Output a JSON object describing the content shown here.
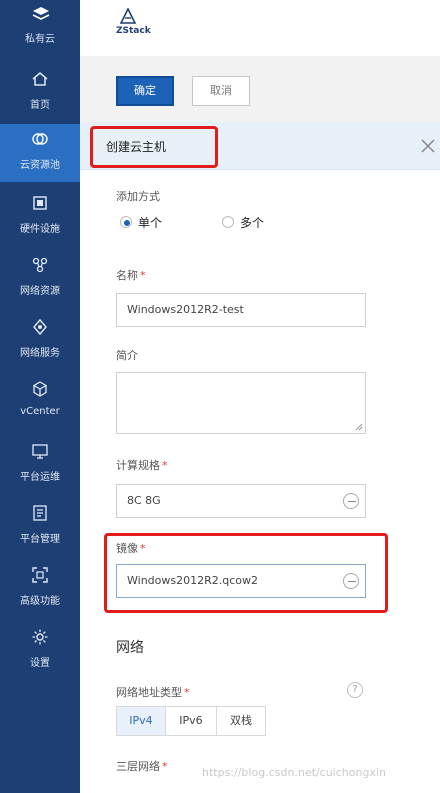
{
  "sidebar": {
    "brand_label": "私有云",
    "items": [
      {
        "label": "首页",
        "icon": "home-icon"
      },
      {
        "label": "云资源池",
        "icon": "cloud-pool-icon",
        "active": true
      },
      {
        "label": "硬件设施",
        "icon": "hardware-icon"
      },
      {
        "label": "网络资源",
        "icon": "network-resource-icon"
      },
      {
        "label": "网络服务",
        "icon": "network-service-icon"
      },
      {
        "label": "vCenter",
        "icon": "vcenter-icon"
      },
      {
        "label": "平台运维",
        "icon": "platform-ops-icon"
      },
      {
        "label": "平台管理",
        "icon": "platform-manage-icon"
      },
      {
        "label": "高级功能",
        "icon": "advanced-icon"
      },
      {
        "label": "设置",
        "icon": "settings-icon"
      }
    ]
  },
  "brand": {
    "name": "ZStack"
  },
  "toolbar": {
    "ok_label": "确定",
    "cancel_label": "取消"
  },
  "page": {
    "title": "创建云主机"
  },
  "form": {
    "add_method_label": "添加方式",
    "add_method_options": [
      "单个",
      "多个"
    ],
    "add_method_selected": "单个",
    "name_label": "名称",
    "name_value": "Windows2012R2-test",
    "desc_label": "简介",
    "desc_value": "",
    "spec_label": "计算规格",
    "spec_value": "8C 8G",
    "image_label": "镜像",
    "image_value": "Windows2012R2.qcow2",
    "network_title": "网络",
    "net_type_label": "网络地址类型",
    "net_type_options": [
      "IPv4",
      "IPv6",
      "双栈"
    ],
    "net_type_selected": "IPv4",
    "l3_label": "三层网络",
    "required_mark": "*",
    "help_mark": "?"
  },
  "watermark": "https://blog.csdn.net/cuichongxin",
  "colors": {
    "sidebar_bg": "#1e3f73",
    "sidebar_active": "#2b6fc2",
    "primary": "#1c63b7",
    "highlight": "#e21b1b"
  }
}
